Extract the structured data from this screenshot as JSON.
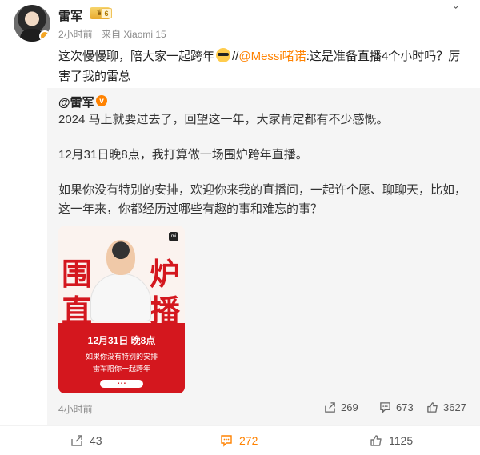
{
  "post": {
    "author": "雷军",
    "crown_level": "6",
    "time": "2小时前",
    "source": "来自 Xiaomi 15",
    "text_before": "这次慢慢聊，陪大家一起跨年",
    "text_sep": "//",
    "mention": "@Messi啫诺",
    "text_after": ":这是准备直播4个小时吗？厉害了我的雷总"
  },
  "repost": {
    "author": "@雷军",
    "verified": "v",
    "para1": "2024 马上就要过去了，回望这一年，大家肯定都有不少感慨。",
    "para2": "12月31日晚8点，我打算做一场围炉跨年直播。",
    "para3": "如果你没有特别的安排，欢迎你来我的直播间，一起许个愿、聊聊天，比如，这一年来，你都经历过哪些有趣的事和难忘的事？",
    "poster": {
      "brand": "mi",
      "big1": "围",
      "big2": "炉",
      "big3": "直",
      "big4": "播",
      "date": "12月31日 晚8点",
      "line1": "如果你没有特别的安排",
      "line2": "雷军陪你一起跨年"
    },
    "time": "4小时前",
    "shares": "269",
    "comments": "673",
    "likes": "3627"
  },
  "footer": {
    "shares": "43",
    "comments": "272",
    "likes": "1125"
  },
  "colors": {
    "accent": "#ff8200",
    "poster_red": "#d4171e"
  }
}
